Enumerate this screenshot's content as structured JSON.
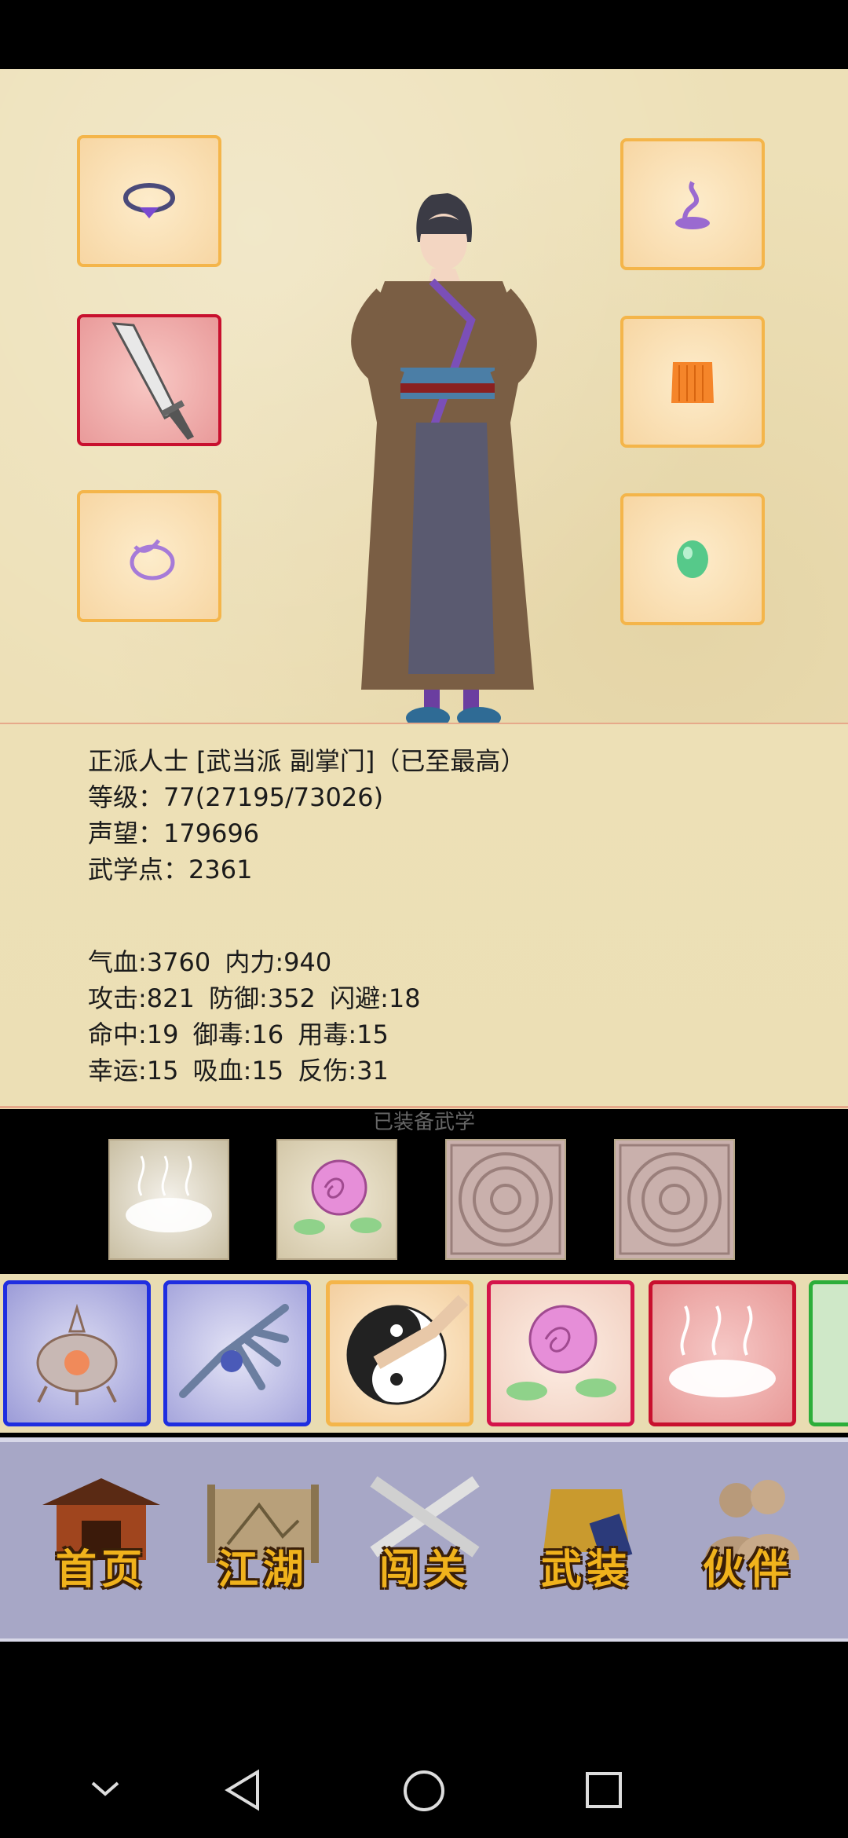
{
  "equipment": {
    "left": [
      "necklace-icon",
      "blade-icon",
      "ring-icon"
    ],
    "right": [
      "hat-icon",
      "robe-icon",
      "jade-icon"
    ]
  },
  "info": {
    "identity": "正派人士 [武当派 副掌门]（已至最高）",
    "level": "等级：77(27195/73026)",
    "reputation": "声望：179696",
    "skill_points": "武学点：2361"
  },
  "stats": {
    "row1": "气血:3760  内力:940",
    "row2": "攻击:821  防御:352  闪避:18",
    "row3": "命中:19  御毒:16  用毒:15",
    "row4": "幸运:15  吸血:15  反伤:31"
  },
  "equipped_skills": {
    "title": "已装备武学",
    "slots": [
      "mist-skill-icon",
      "rose-skill-icon",
      "empty-seal-icon",
      "empty-seal-icon"
    ]
  },
  "skill_cards": [
    {
      "icon": "incense-burner-icon",
      "border": "#1f2ee0"
    },
    {
      "icon": "palm-icon",
      "border": "#1f2ee0"
    },
    {
      "icon": "taiji-fist-icon",
      "border": "#f4b54a"
    },
    {
      "icon": "rose-icon",
      "border": "#d4144a"
    },
    {
      "icon": "mist-icon",
      "border": "#c8102e"
    },
    {
      "icon": "partial-card",
      "border": "#2cae3a"
    }
  ],
  "nav": {
    "home": "首页",
    "jianghu": "江湖",
    "challenge": "闯关",
    "equip": "武装",
    "partner": "伙伴"
  }
}
